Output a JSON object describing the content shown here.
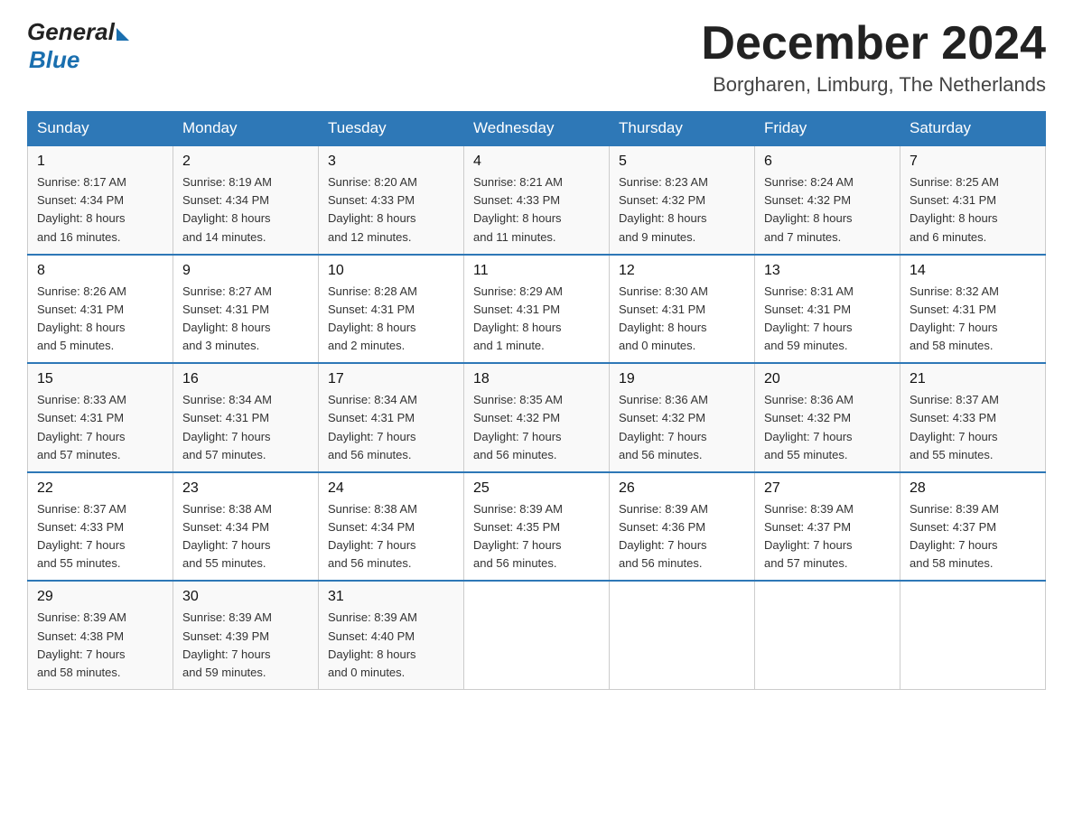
{
  "header": {
    "logo_general": "General",
    "logo_blue": "Blue",
    "month_title": "December 2024",
    "location": "Borgharen, Limburg, The Netherlands"
  },
  "days_of_week": [
    "Sunday",
    "Monday",
    "Tuesday",
    "Wednesday",
    "Thursday",
    "Friday",
    "Saturday"
  ],
  "weeks": [
    [
      {
        "day": "1",
        "sunrise": "8:17 AM",
        "sunset": "4:34 PM",
        "daylight": "8 hours and 16 minutes."
      },
      {
        "day": "2",
        "sunrise": "8:19 AM",
        "sunset": "4:34 PM",
        "daylight": "8 hours and 14 minutes."
      },
      {
        "day": "3",
        "sunrise": "8:20 AM",
        "sunset": "4:33 PM",
        "daylight": "8 hours and 12 minutes."
      },
      {
        "day": "4",
        "sunrise": "8:21 AM",
        "sunset": "4:33 PM",
        "daylight": "8 hours and 11 minutes."
      },
      {
        "day": "5",
        "sunrise": "8:23 AM",
        "sunset": "4:32 PM",
        "daylight": "8 hours and 9 minutes."
      },
      {
        "day": "6",
        "sunrise": "8:24 AM",
        "sunset": "4:32 PM",
        "daylight": "8 hours and 7 minutes."
      },
      {
        "day": "7",
        "sunrise": "8:25 AM",
        "sunset": "4:31 PM",
        "daylight": "8 hours and 6 minutes."
      }
    ],
    [
      {
        "day": "8",
        "sunrise": "8:26 AM",
        "sunset": "4:31 PM",
        "daylight": "8 hours and 5 minutes."
      },
      {
        "day": "9",
        "sunrise": "8:27 AM",
        "sunset": "4:31 PM",
        "daylight": "8 hours and 3 minutes."
      },
      {
        "day": "10",
        "sunrise": "8:28 AM",
        "sunset": "4:31 PM",
        "daylight": "8 hours and 2 minutes."
      },
      {
        "day": "11",
        "sunrise": "8:29 AM",
        "sunset": "4:31 PM",
        "daylight": "8 hours and 1 minute."
      },
      {
        "day": "12",
        "sunrise": "8:30 AM",
        "sunset": "4:31 PM",
        "daylight": "8 hours and 0 minutes."
      },
      {
        "day": "13",
        "sunrise": "8:31 AM",
        "sunset": "4:31 PM",
        "daylight": "7 hours and 59 minutes."
      },
      {
        "day": "14",
        "sunrise": "8:32 AM",
        "sunset": "4:31 PM",
        "daylight": "7 hours and 58 minutes."
      }
    ],
    [
      {
        "day": "15",
        "sunrise": "8:33 AM",
        "sunset": "4:31 PM",
        "daylight": "7 hours and 57 minutes."
      },
      {
        "day": "16",
        "sunrise": "8:34 AM",
        "sunset": "4:31 PM",
        "daylight": "7 hours and 57 minutes."
      },
      {
        "day": "17",
        "sunrise": "8:34 AM",
        "sunset": "4:31 PM",
        "daylight": "7 hours and 56 minutes."
      },
      {
        "day": "18",
        "sunrise": "8:35 AM",
        "sunset": "4:32 PM",
        "daylight": "7 hours and 56 minutes."
      },
      {
        "day": "19",
        "sunrise": "8:36 AM",
        "sunset": "4:32 PM",
        "daylight": "7 hours and 56 minutes."
      },
      {
        "day": "20",
        "sunrise": "8:36 AM",
        "sunset": "4:32 PM",
        "daylight": "7 hours and 55 minutes."
      },
      {
        "day": "21",
        "sunrise": "8:37 AM",
        "sunset": "4:33 PM",
        "daylight": "7 hours and 55 minutes."
      }
    ],
    [
      {
        "day": "22",
        "sunrise": "8:37 AM",
        "sunset": "4:33 PM",
        "daylight": "7 hours and 55 minutes."
      },
      {
        "day": "23",
        "sunrise": "8:38 AM",
        "sunset": "4:34 PM",
        "daylight": "7 hours and 55 minutes."
      },
      {
        "day": "24",
        "sunrise": "8:38 AM",
        "sunset": "4:34 PM",
        "daylight": "7 hours and 56 minutes."
      },
      {
        "day": "25",
        "sunrise": "8:39 AM",
        "sunset": "4:35 PM",
        "daylight": "7 hours and 56 minutes."
      },
      {
        "day": "26",
        "sunrise": "8:39 AM",
        "sunset": "4:36 PM",
        "daylight": "7 hours and 56 minutes."
      },
      {
        "day": "27",
        "sunrise": "8:39 AM",
        "sunset": "4:37 PM",
        "daylight": "7 hours and 57 minutes."
      },
      {
        "day": "28",
        "sunrise": "8:39 AM",
        "sunset": "4:37 PM",
        "daylight": "7 hours and 58 minutes."
      }
    ],
    [
      {
        "day": "29",
        "sunrise": "8:39 AM",
        "sunset": "4:38 PM",
        "daylight": "7 hours and 58 minutes."
      },
      {
        "day": "30",
        "sunrise": "8:39 AM",
        "sunset": "4:39 PM",
        "daylight": "7 hours and 59 minutes."
      },
      {
        "day": "31",
        "sunrise": "8:39 AM",
        "sunset": "4:40 PM",
        "daylight": "8 hours and 0 minutes."
      },
      null,
      null,
      null,
      null
    ]
  ],
  "labels": {
    "sunrise_prefix": "Sunrise: ",
    "sunset_prefix": "Sunset: ",
    "daylight_prefix": "Daylight: "
  }
}
